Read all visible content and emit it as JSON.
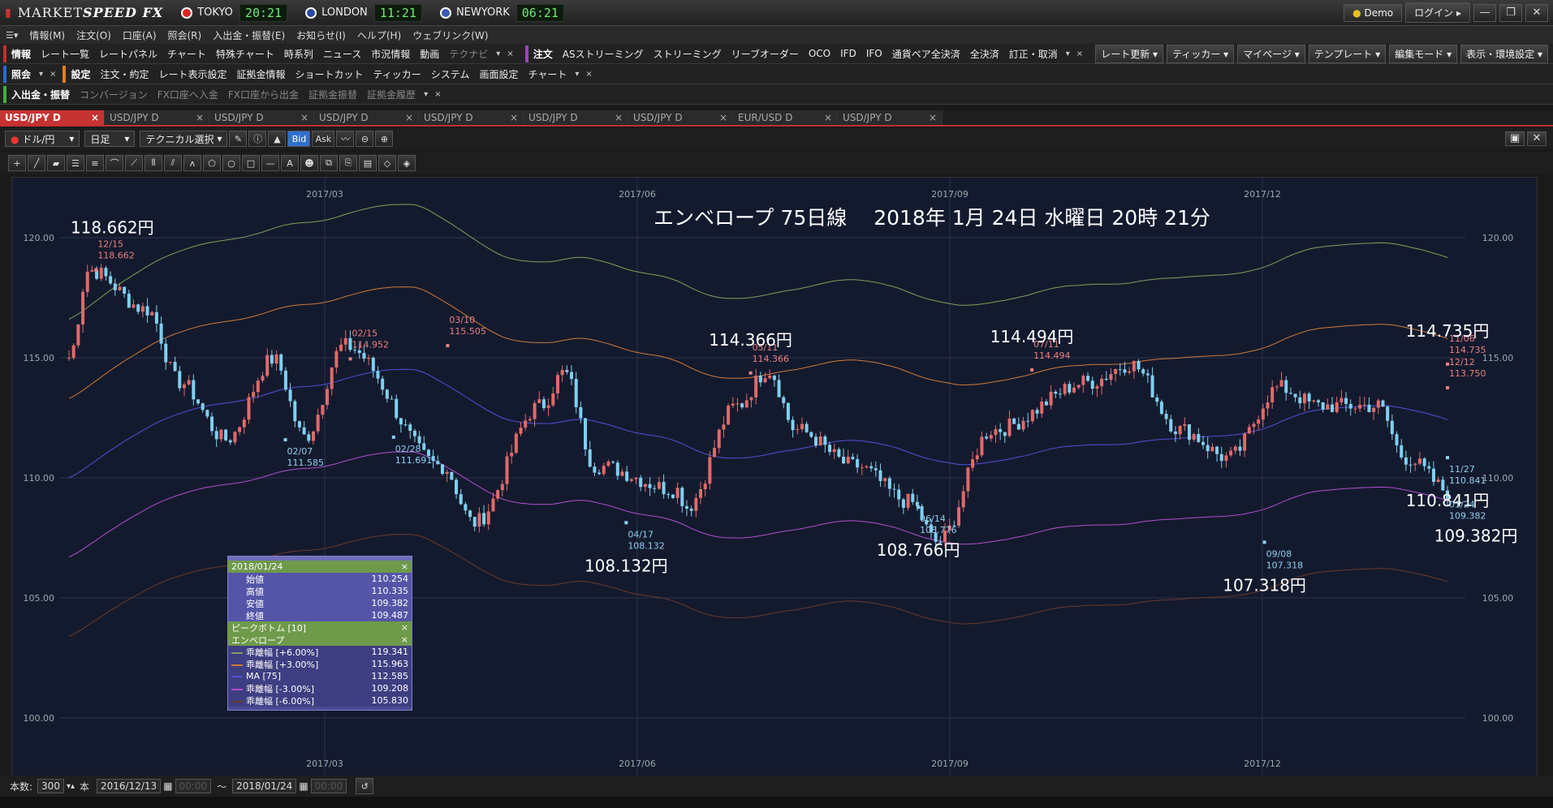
{
  "app": {
    "logo_text": "MARKET",
    "logo_bold": "SPEED FX",
    "clocks": [
      {
        "city": "TOKYO",
        "time": "20:21",
        "color": "#d22"
      },
      {
        "city": "LONDON",
        "time": "11:21",
        "color": "#2a4aa0"
      },
      {
        "city": "NEWYORK",
        "time": "06:21",
        "color": "#3a5ab0"
      }
    ],
    "demo": "Demo",
    "login": "ログイン"
  },
  "menu": [
    "情報(M)",
    "注文(O)",
    "口座(A)",
    "照会(R)",
    "入出金・振替(E)",
    "お知らせ(I)",
    "ヘルプ(H)",
    "ウェブリンク(W)"
  ],
  "row1": {
    "grp1": "情報",
    "items1": [
      "レート一覧",
      "レートパネル",
      "チャート",
      "特殊チャート",
      "時系列",
      "ニュース",
      "市況情報",
      "動画"
    ],
    "dim1": "テクナビ",
    "grp2": "注文",
    "items2": [
      "ASストリーミング",
      "ストリーミング",
      "リーブオーダー",
      "OCO",
      "IFD",
      "IFO",
      "通貨ペア全決済",
      "全決済",
      "訂正・取消"
    ],
    "right": [
      "レート更新",
      "ティッカー",
      "マイページ",
      "テンプレート",
      "編集モード",
      "表示・環境設定"
    ]
  },
  "row2": {
    "grp1": "照会",
    "grp2": "設定",
    "items": [
      "注文・約定",
      "レート表示設定",
      "証拠金情報",
      "ショートカット",
      "ティッカー",
      "システム",
      "画面設定",
      "チャート"
    ]
  },
  "row3": {
    "grp1": "入出金・振替",
    "items": [
      "コンバージョン",
      "FX口座へ入金",
      "FX口座から出金",
      "証拠金振替",
      "証拠金履歴"
    ]
  },
  "tabs": [
    "USD/JPY D",
    "USD/JPY D",
    "USD/JPY D",
    "USD/JPY D",
    "USD/JPY D",
    "USD/JPY D",
    "USD/JPY D",
    "EUR/USD D",
    "USD/JPY D"
  ],
  "toolbar": {
    "pair": "ドル/円",
    "period": "日足",
    "tech": "テクニカル選択",
    "bid": "Bid",
    "ask": "Ask"
  },
  "bottom": {
    "count_label": "本数:",
    "count": "300",
    "unit": "本",
    "from": "2016/12/13",
    "from_time": "00:00",
    "tilde": "〜",
    "to": "2018/01/24",
    "to_time": "00:00"
  },
  "chart_data": {
    "type": "candlestick",
    "title": "エンベロープ 75日線　 2018年 1月 24日 水曜日 20時 21分",
    "x_labels": [
      "2017/03",
      "2017/06",
      "2017/09",
      "2017/12"
    ],
    "y_ticks": [
      "120.00",
      "115.00",
      "110.00",
      "105.00",
      "100.00"
    ],
    "ylim": [
      97.5,
      122.5
    ],
    "colors": {
      "up": "#e06a6a",
      "down": "#7fd0ee",
      "ma": "#5050d8",
      "plus6": "#7fa05a",
      "plus3": "#d07a38",
      "minus3": "#b050d0",
      "minus6": "#6a3a2a"
    },
    "peaks": [
      {
        "date": "12/15",
        "value": "118.662",
        "big": "118.662円",
        "type": "high"
      },
      {
        "date": "02/15",
        "value": "114.952",
        "type": "high"
      },
      {
        "date": "03/10",
        "value": "115.505",
        "type": "high"
      },
      {
        "date": "05/11",
        "value": "114.366",
        "big": "114.366円",
        "type": "high"
      },
      {
        "date": "07/11",
        "value": "114.494",
        "big": "114.494円",
        "type": "high"
      },
      {
        "date": "11/06",
        "value": "114.735",
        "big": "114.735円",
        "type": "high"
      },
      {
        "date": "12/12",
        "value": "113.750",
        "type": "high"
      },
      {
        "date": "02/07",
        "value": "111.585",
        "type": "low"
      },
      {
        "date": "02/28",
        "value": "111.691",
        "type": "low"
      },
      {
        "date": "04/17",
        "value": "108.132",
        "big": "108.132円",
        "type": "low"
      },
      {
        "date": "06/14",
        "value": "108.776",
        "big": "108.766円",
        "type": "low"
      },
      {
        "date": "09/08",
        "value": "107.318",
        "big": "107.318円",
        "type": "low"
      },
      {
        "date": "11/27",
        "value": "110.841",
        "big": "110.841円",
        "type": "low"
      },
      {
        "date": "01/24",
        "value": "109.382",
        "big": "109.382円",
        "type": "low"
      }
    ]
  },
  "popup": {
    "date": "2018/01/24",
    "rows": [
      [
        "始値",
        "110.254"
      ],
      [
        "高値",
        "110.335"
      ],
      [
        "安値",
        "109.382"
      ],
      [
        "終値",
        "109.487"
      ]
    ],
    "sec1": "ピークボトム [10]",
    "sec2": "エンベロープ",
    "env": [
      [
        "乖離幅 [+6.00%]",
        "119.341",
        "#7fa05a"
      ],
      [
        "乖離幅 [+3.00%]",
        "115.963",
        "#d07a38"
      ],
      [
        "MA [75]",
        "112.585",
        "#5050d8"
      ],
      [
        "乖離幅 [-3.00%]",
        "109.208",
        "#b050d0"
      ],
      [
        "乖離幅 [-6.00%]",
        "105.830",
        "#6a3a2a"
      ]
    ]
  }
}
